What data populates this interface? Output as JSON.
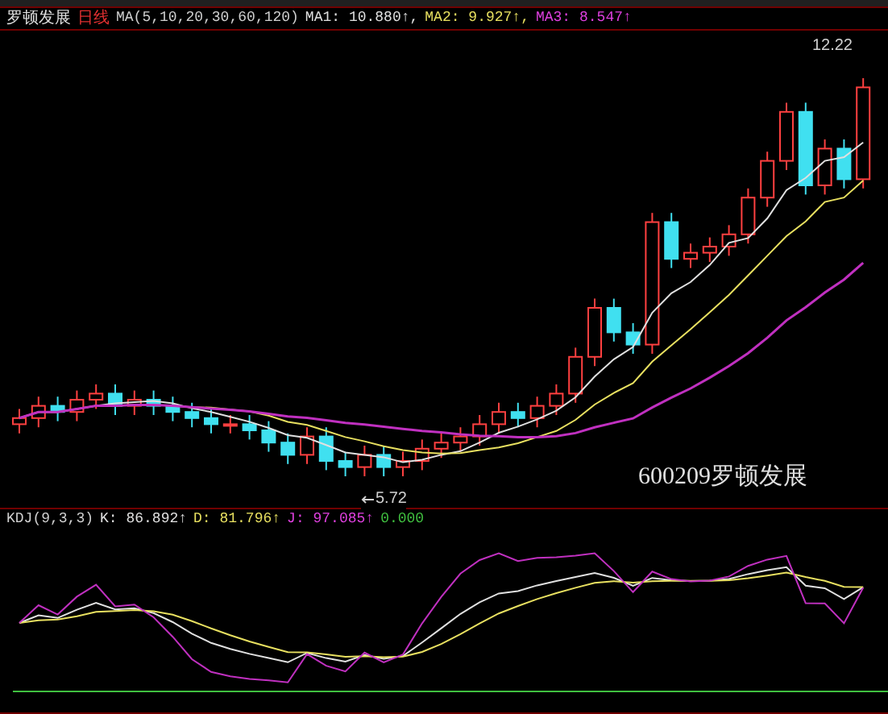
{
  "main_header": {
    "name": "罗顿发展",
    "period": "日线",
    "ma_spec": "MA(5,10,20,30,60,120)",
    "ma_values": [
      {
        "label": "MA1:",
        "value": "10.880↑,",
        "color": "#e0e0e0"
      },
      {
        "label": "MA2:",
        "value": "9.927↑,",
        "color": "#e8e060"
      },
      {
        "label": "MA3:",
        "value": "8.547↑",
        "color": "#e040e0"
      }
    ]
  },
  "annotations": {
    "high": "12.22",
    "low": "5.72"
  },
  "caption": "600209罗顿发展",
  "kdj_header": {
    "spec": "KDJ(9,3,3)",
    "values": [
      {
        "label": "K:",
        "value": "86.892↑",
        "color": "#e0e0e0"
      },
      {
        "label": "D:",
        "value": "81.796↑",
        "color": "#e8e060"
      },
      {
        "label": "J:",
        "value": "97.085↑",
        "color": "#e040e0"
      },
      {
        "value": "0.000",
        "color": "#40c040"
      }
    ]
  }
}
